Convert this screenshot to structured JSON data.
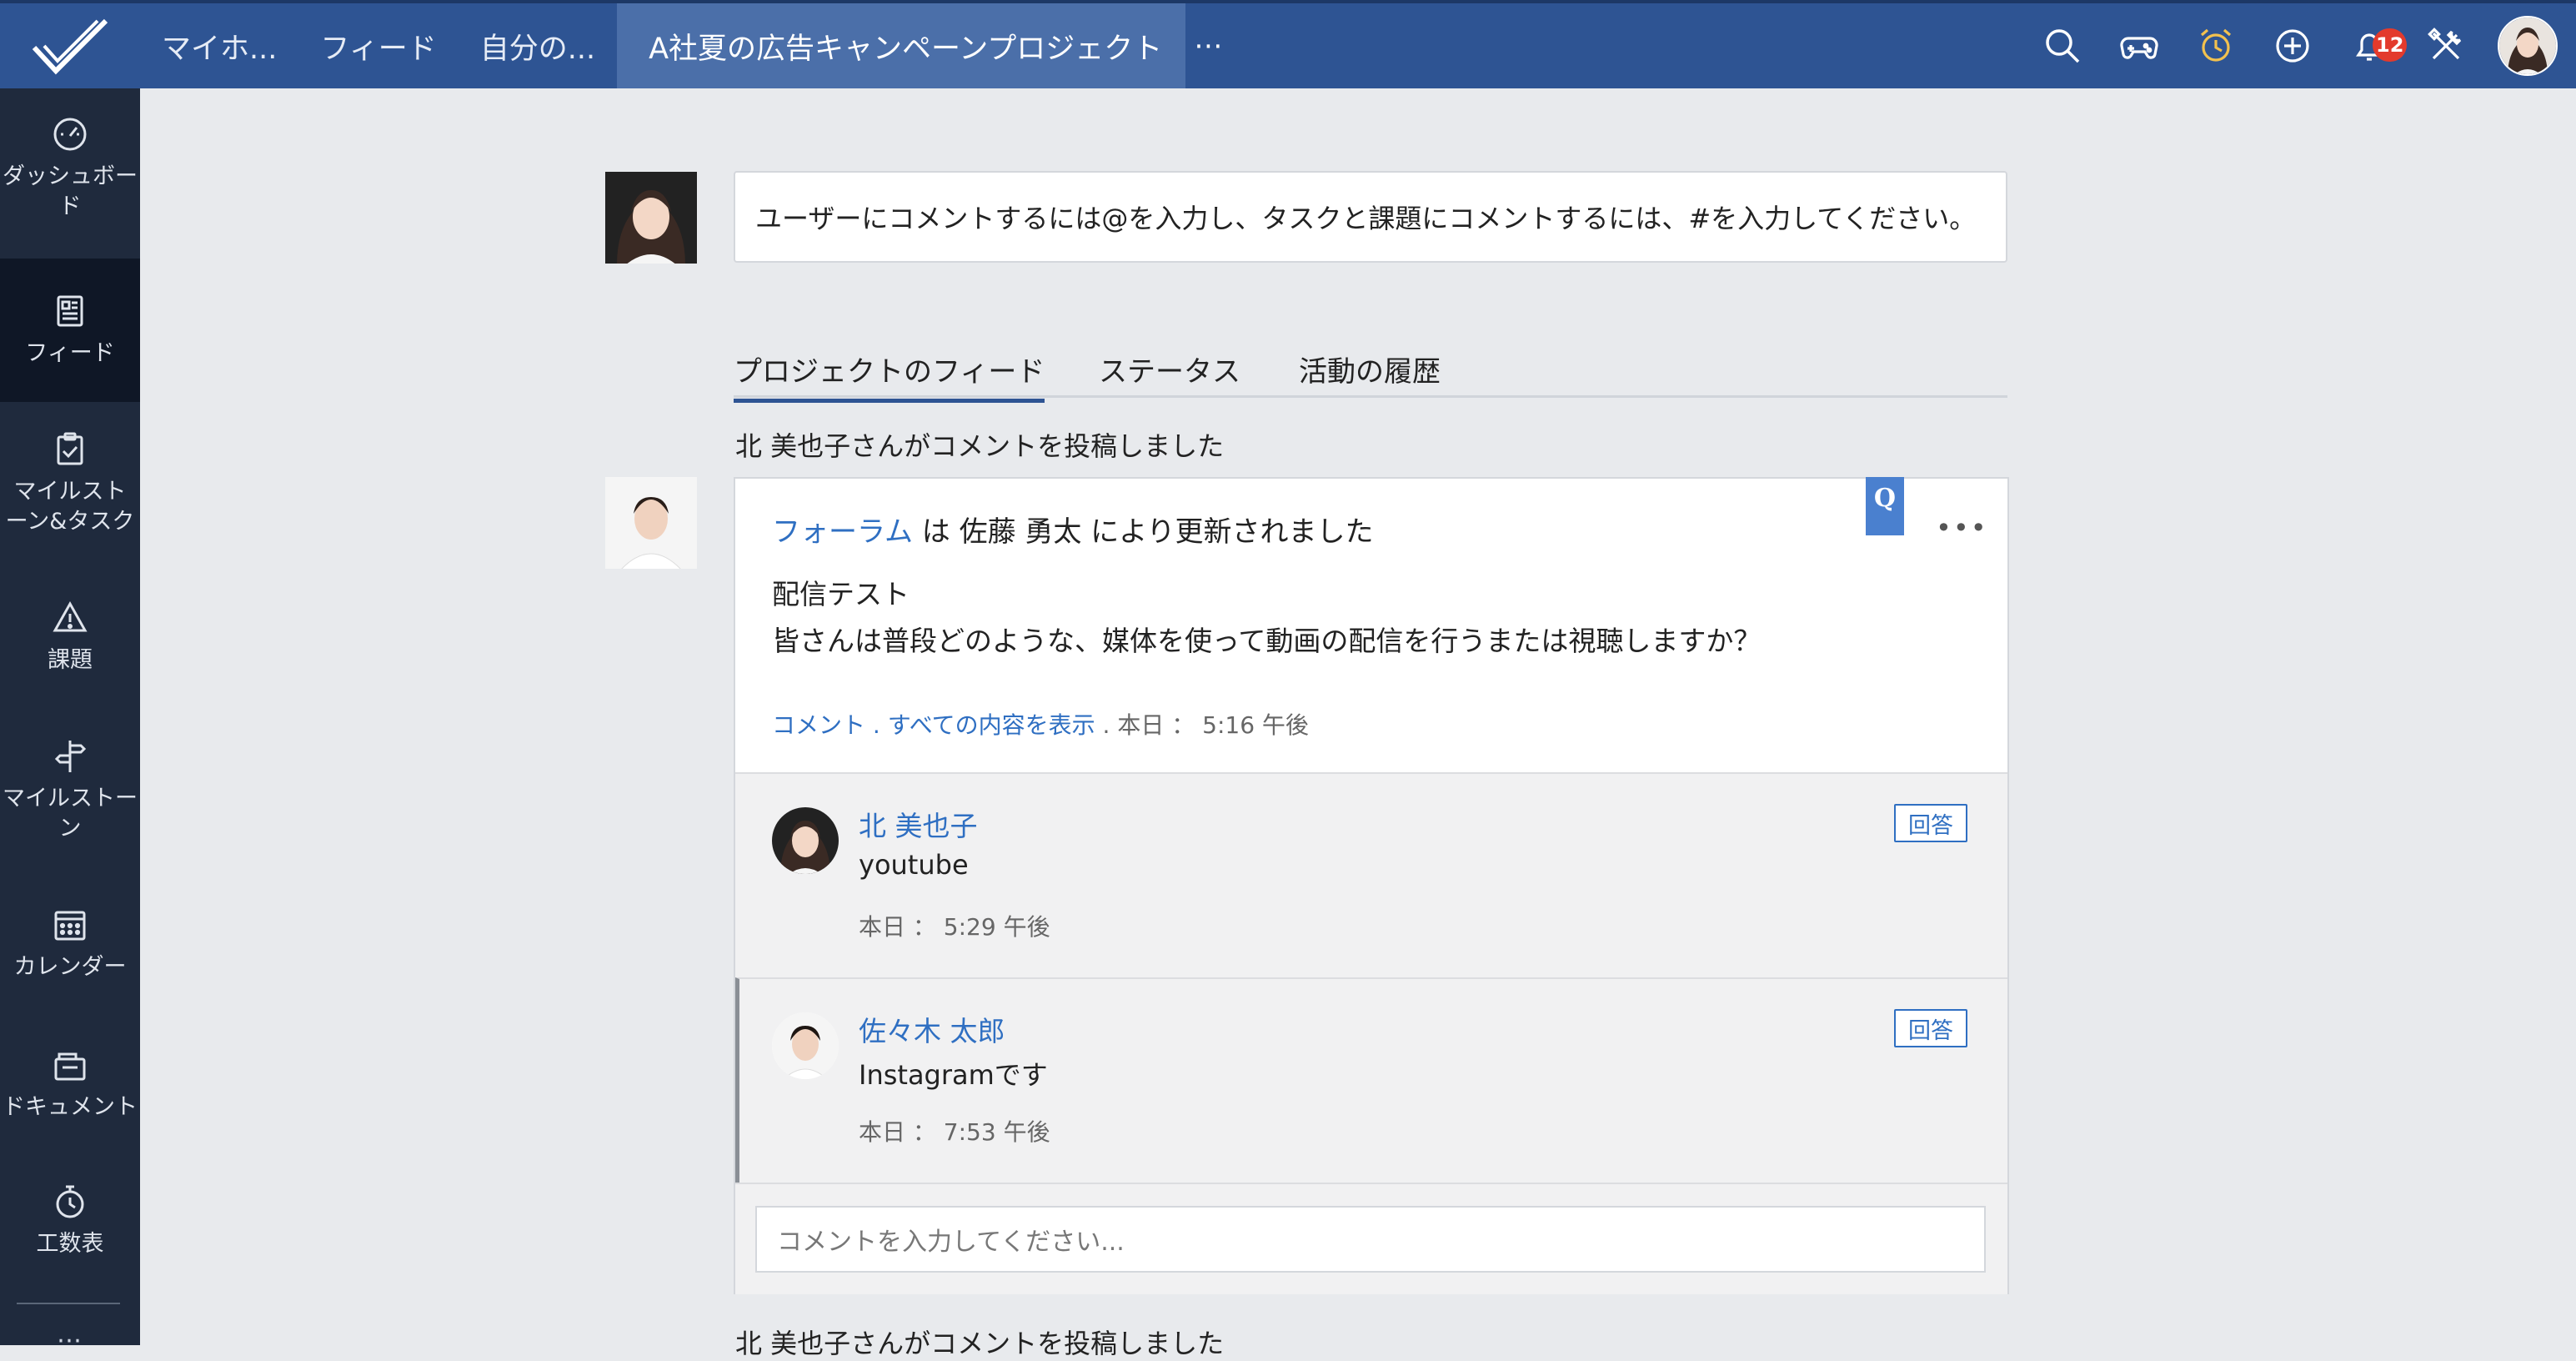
{
  "colors": {
    "topbar": "#2e5493",
    "active_tab": "#4b6fa9",
    "sidebar": "#1f2a3d",
    "link": "#2f6fc2",
    "badge": "#e33a2c"
  },
  "top_tabs": [
    {
      "label": "マイホ..."
    },
    {
      "label": "フィード"
    },
    {
      "label": "自分の..."
    },
    {
      "label": "A社夏の広告キャンペーンプロジェクト"
    }
  ],
  "top_more": "⋯",
  "top_icons": [
    "search-icon",
    "game-controller-icon",
    "alarm-clock-icon",
    "add-icon",
    "bell-icon",
    "tools-icon"
  ],
  "notification_count": "12",
  "sidebar": {
    "items": [
      {
        "label": "ダッシュボード",
        "icon": "dashboard-icon"
      },
      {
        "label": "フィード",
        "icon": "feed-icon"
      },
      {
        "label": "マイルストーン&タスク",
        "icon": "clipboard-check-icon"
      },
      {
        "label": "課題",
        "icon": "warning-icon"
      },
      {
        "label": "マイルストーン",
        "icon": "signpost-icon"
      },
      {
        "label": "カレンダー",
        "icon": "calendar-icon"
      },
      {
        "label": "ドキュメント",
        "icon": "folder-icon"
      },
      {
        "label": "工数表",
        "icon": "timer-icon"
      }
    ],
    "more": "⋯"
  },
  "comment_prompt": "ユーザーにコメントするには@を入力し、タスクと課題にコメントするには、#を入力してください。",
  "feed_tabs": [
    "プロジェクトのフィード",
    "ステータス",
    "活動の履歴"
  ],
  "posts": [
    {
      "posted_by": "北 美也子さんがコメントを投稿しました",
      "head_link": "フォーラム",
      "head_mid": " は ",
      "head_user": "佐藤 勇太",
      "head_tail": " により更新されました",
      "q_badge": "Q",
      "menu": "•••",
      "title": "配信テスト",
      "body": "皆さんは普段どのような、媒体を使って動画の配信を行うまたは視聴しますか？",
      "meta_comment": "コメント",
      "meta_sep1": " . ",
      "meta_show_all": "すべての内容を表示",
      "meta_sep2": " . ",
      "meta_time": "本日 ： 5:16 午後",
      "replies": [
        {
          "name": "北 美也子",
          "text": "youtube",
          "time": "本日 ： 5:29 午後",
          "reply_label": "回答"
        },
        {
          "name": "佐々木 太郎",
          "text": "Instagramです",
          "time": "本日 ： 7:53 午後",
          "reply_label": "回答"
        }
      ],
      "comment_placeholder": "コメントを入力してください..."
    },
    {
      "posted_by": "北 美也子さんがコメントを投稿しました"
    }
  ]
}
